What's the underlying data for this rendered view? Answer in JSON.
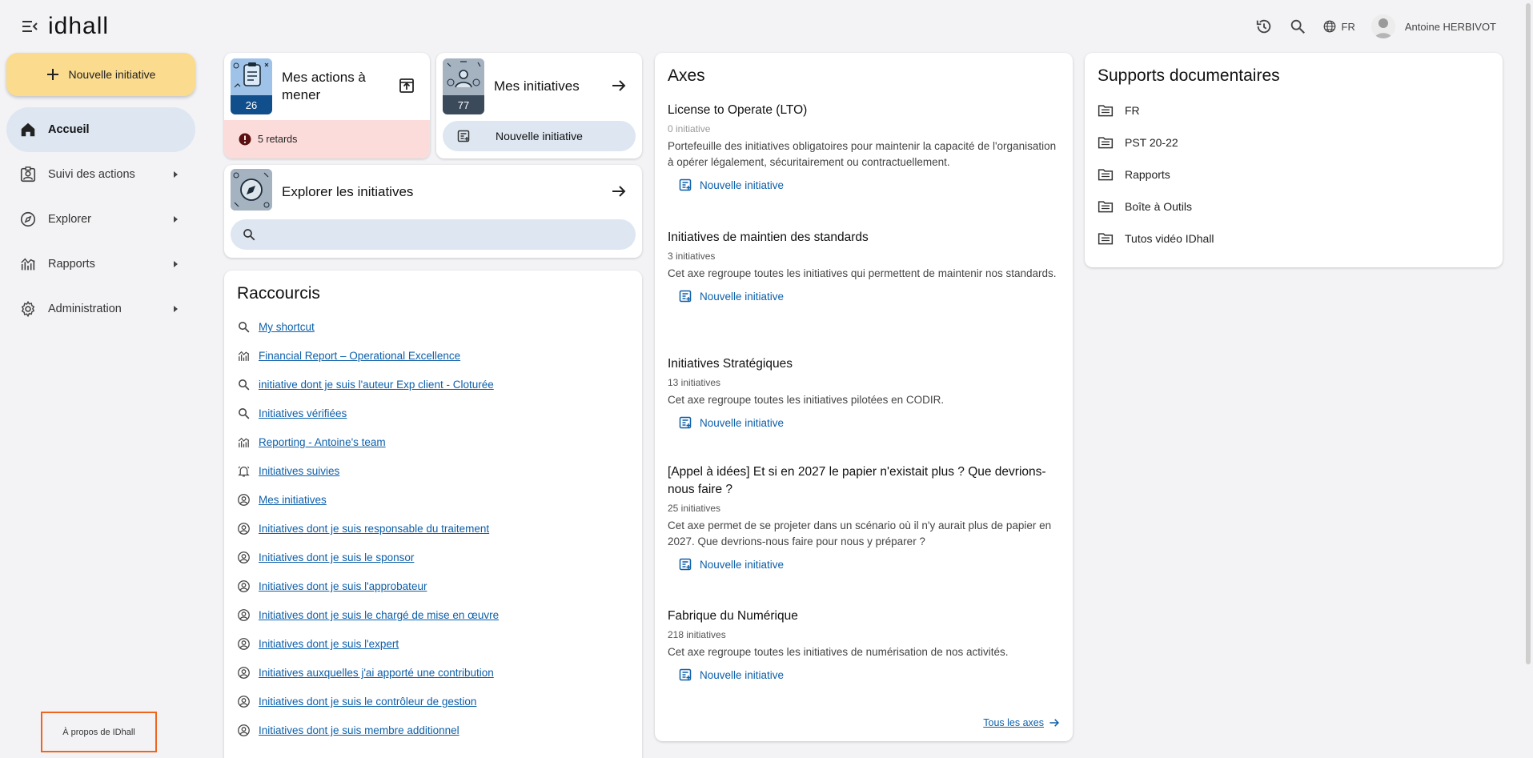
{
  "header": {
    "logo": "idhall",
    "language": "FR",
    "user_name": "Antoine HERBIVOT"
  },
  "sidebar": {
    "new_button": "Nouvelle initiative",
    "items": [
      {
        "label": "Accueil",
        "icon": "home-icon",
        "active": true
      },
      {
        "label": "Suivi des actions",
        "icon": "clipboard-user-icon"
      },
      {
        "label": "Explorer",
        "icon": "compass-icon"
      },
      {
        "label": "Rapports",
        "icon": "chart-icon"
      },
      {
        "label": "Administration",
        "icon": "gear-icon"
      }
    ],
    "about": "À propos de IDhall"
  },
  "cards": {
    "actions": {
      "title": "Mes actions à mener",
      "count": "26",
      "late": "5 retards"
    },
    "initiatives": {
      "title": "Mes initiatives",
      "count": "77",
      "new_button": "Nouvelle initiative"
    },
    "explore": {
      "title": "Explorer les initiatives",
      "search_placeholder": ""
    }
  },
  "shortcuts": {
    "title": "Raccourcis",
    "items": [
      {
        "label": "My shortcut",
        "icon": "search-icon"
      },
      {
        "label": "Financial Report – Operational Excellence",
        "icon": "chart-icon"
      },
      {
        "label": "initiative dont je suis l'auteur Exp client - Cloturée",
        "icon": "search-icon"
      },
      {
        "label": "Initiatives vérifiées",
        "icon": "search-icon"
      },
      {
        "label": "Reporting - Antoine's team",
        "icon": "chart-icon"
      },
      {
        "label": "Initiatives suivies",
        "icon": "bell-icon"
      },
      {
        "label": "Mes initiatives",
        "icon": "user-circle-icon"
      },
      {
        "label": "Initiatives dont je suis responsable du traitement",
        "icon": "user-circle-icon"
      },
      {
        "label": "Initiatives dont je suis le sponsor",
        "icon": "user-circle-icon"
      },
      {
        "label": "Initiatives dont je suis l'approbateur",
        "icon": "user-circle-icon"
      },
      {
        "label": "Initiatives dont je suis le chargé de mise en œuvre",
        "icon": "user-circle-icon"
      },
      {
        "label": "Initiatives dont je suis l'expert",
        "icon": "user-circle-icon"
      },
      {
        "label": "Initiatives auxquelles j'ai apporté une contribution",
        "icon": "user-circle-icon"
      },
      {
        "label": "Initiatives dont je suis le contrôleur de gestion",
        "icon": "user-circle-icon"
      },
      {
        "label": "Initiatives dont je suis membre additionnel",
        "icon": "user-circle-icon"
      }
    ]
  },
  "axes": {
    "title": "Axes",
    "items": [
      {
        "name": "License to Operate (LTO)",
        "count": "0 initiative",
        "description": "Portefeuille des initiatives obligatoires pour maintenir la capacité de l'organisation à opérer légalement, sécuritairement ou contractuellement.",
        "action": "Nouvelle initiative"
      },
      {
        "name": "Initiatives de maintien des standards",
        "count": "3 initiatives",
        "description": "Cet axe regroupe toutes les initiatives qui permettent de maintenir nos standards.",
        "action": "Nouvelle initiative"
      },
      {
        "name": "Initiatives Stratégiques",
        "count": "13 initiatives",
        "description": "Cet axe regroupe toutes les initiatives pilotées en CODIR.",
        "action": "Nouvelle initiative"
      },
      {
        "name": "[Appel à idées] Et si en 2027 le papier n'existait plus ? Que devrions-nous faire ?",
        "count": "25 initiatives",
        "description": "Cet axe permet de se projeter dans un scénario où il n'y aurait plus de papier en 2027. Que devrions-nous faire pour nous y préparer ?",
        "action": "Nouvelle initiative"
      },
      {
        "name": "Fabrique du Numérique",
        "count": "218 initiatives",
        "description": "Cet axe regroupe toutes les initiatives de numérisation de nos activités.",
        "action": "Nouvelle initiative"
      }
    ],
    "all_link": "Tous les axes"
  },
  "supports": {
    "title": "Supports documentaires",
    "folders": [
      "FR",
      "PST 20-22",
      "Rapports",
      "Boîte à Outils",
      "Tutos vidéo IDhall"
    ]
  }
}
